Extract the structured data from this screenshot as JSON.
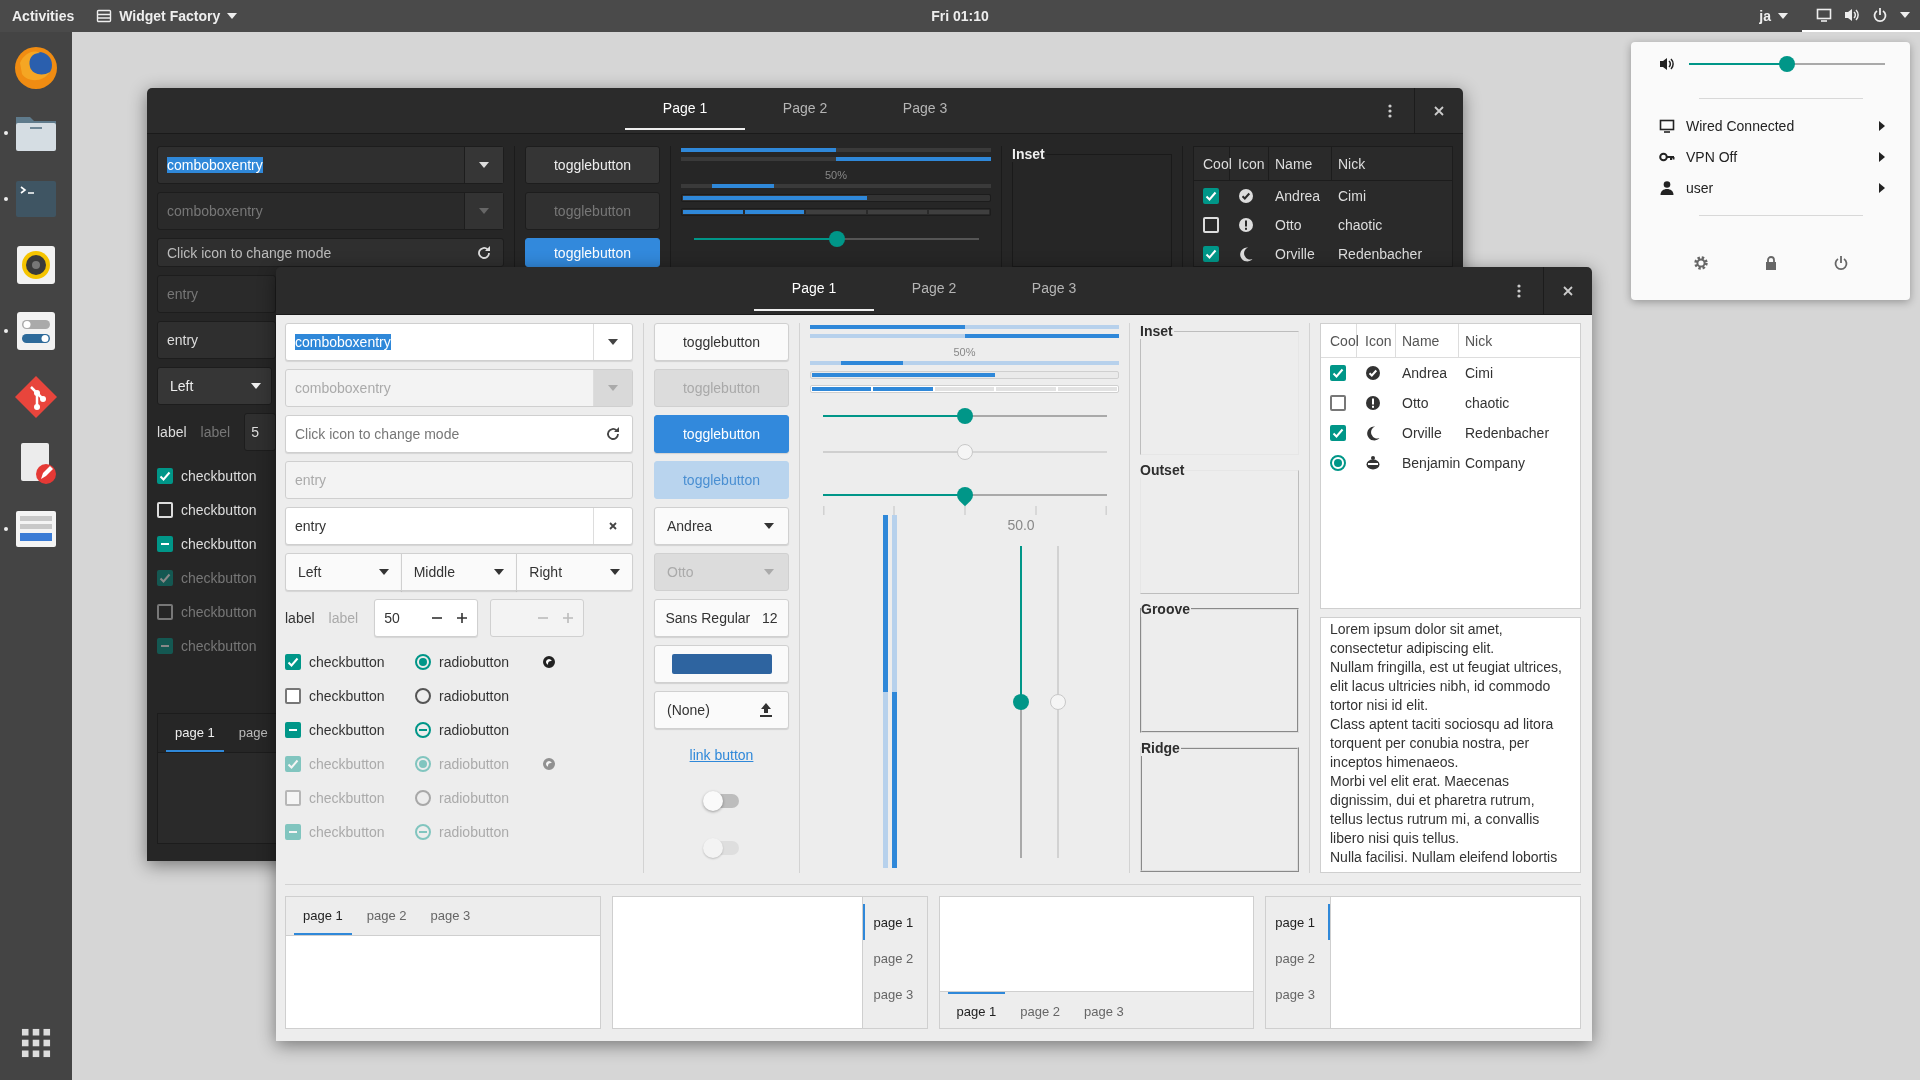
{
  "top_bar": {
    "activities": "Activities",
    "app_menu": "Widget Factory",
    "clock": "Fri 01:10",
    "input_source": "ja"
  },
  "dock": [
    {
      "kind": "browser",
      "running": false
    },
    {
      "kind": "files",
      "running": true
    },
    {
      "kind": "terminal",
      "running": true
    },
    {
      "kind": "music",
      "running": false
    },
    {
      "kind": "settings",
      "running": true
    },
    {
      "kind": "git",
      "running": false
    },
    {
      "kind": "editor",
      "running": false
    },
    {
      "kind": "widgets",
      "running": true
    }
  ],
  "system_menu": {
    "volume": {
      "level": 0.5
    },
    "items": [
      {
        "kind": "network",
        "label": "Wired Connected"
      },
      {
        "kind": "vpn",
        "label": "VPN Off"
      },
      {
        "kind": "user",
        "label": "user"
      }
    ]
  },
  "back_window": {
    "tabs": [
      {
        "label": "Page 1",
        "selected": true
      },
      {
        "label": "Page 2",
        "selected": false
      },
      {
        "label": "Page 3",
        "selected": false
      }
    ],
    "combo_entries": [
      {
        "value": "comboboxentry",
        "text_selected": true,
        "disabled": false
      },
      {
        "value": "comboboxentry",
        "text_selected": false,
        "disabled": true
      }
    ],
    "mode_entry": {
      "placeholder": "Click icon to change mode"
    },
    "entries": [
      {
        "value": "entry",
        "disabled": true
      },
      {
        "value": "entry",
        "disabled": false
      }
    ],
    "combo": {
      "value": "Left"
    },
    "labels": [
      {
        "text": "label",
        "disabled": false
      },
      {
        "text": "label",
        "disabled": true
      }
    ],
    "spin": {
      "value": "5"
    },
    "checkbuttons": [
      {
        "label": "checkbutton",
        "checked": true,
        "inconsistent": false,
        "disabled": false
      },
      {
        "label": "checkbutton",
        "checked": false,
        "inconsistent": false,
        "disabled": false
      },
      {
        "label": "checkbutton",
        "inconsistent": true,
        "disabled": false
      },
      {
        "label": "checkbutton",
        "checked": true,
        "inconsistent": false,
        "disabled": true
      },
      {
        "label": "checkbutton",
        "checked": false,
        "inconsistent": false,
        "disabled": true
      },
      {
        "label": "checkbutton",
        "inconsistent": true,
        "disabled": true
      }
    ],
    "togglebuttons": [
      {
        "label": "togglebutton",
        "active": false,
        "disabled": false
      },
      {
        "label": "togglebutton",
        "active": false,
        "disabled": true
      },
      {
        "label": "togglebutton",
        "active": true,
        "disabled": false
      }
    ],
    "progress": [
      {
        "kind": "plain",
        "level": 0.5
      },
      {
        "kind": "inverted",
        "level": 0.5
      },
      {
        "kind": "pulse"
      },
      {
        "kind": "trough",
        "level": 0.6
      },
      {
        "kind": "segmented",
        "level": 0.4
      }
    ],
    "progress_text": "50%",
    "scale": {
      "level": 0.5
    },
    "frame": {
      "label": "Inset"
    },
    "tree": {
      "columns": [
        "Cool",
        "Icon",
        "Name",
        "Nick"
      ],
      "rows": [
        {
          "kind": "check",
          "checked": true,
          "name": "Andrea",
          "nick": "Cimi"
        },
        {
          "kind": "check",
          "checked": false,
          "name": "Otto",
          "nick": "chaotic"
        },
        {
          "kind": "check",
          "checked": true,
          "name": "Orville",
          "nick": "Redenbacher"
        }
      ]
    },
    "notebook": {
      "tabs": [
        {
          "label": "page 1",
          "selected": true
        },
        {
          "label": "page",
          "selected": false
        }
      ]
    }
  },
  "front_window": {
    "tabs": [
      {
        "label": "Page 1",
        "selected": true
      },
      {
        "label": "Page 2",
        "selected": false
      },
      {
        "label": "Page 3",
        "selected": false
      }
    ],
    "combo_entries": [
      {
        "value": "comboboxentry",
        "text_selected": true,
        "disabled": false
      },
      {
        "value": "comboboxentry",
        "text_selected": false,
        "disabled": true
      }
    ],
    "mode_entry": {
      "placeholder": "Click icon to change mode"
    },
    "entries": [
      {
        "value": "entry",
        "disabled": true,
        "clearable": false
      },
      {
        "value": "entry",
        "disabled": false,
        "clearable": true
      }
    ],
    "linked_combos": [
      {
        "value": "Left"
      },
      {
        "value": "Middle"
      },
      {
        "value": "Right"
      }
    ],
    "labels": [
      {
        "text": "label",
        "disabled": false
      },
      {
        "text": "label",
        "disabled": true
      }
    ],
    "spins": [
      {
        "value": "50",
        "disabled": false
      },
      {
        "disabled": true
      }
    ],
    "check_rows": [
      {
        "disabled": false,
        "check": {
          "label": "checkbutton",
          "checked": true,
          "inconsistent": false
        },
        "radio": {
          "label": "radiobutton",
          "checked": true,
          "inconsistent": false
        },
        "dot": true
      },
      {
        "disabled": false,
        "check": {
          "label": "checkbutton",
          "checked": false,
          "inconsistent": false
        },
        "radio": {
          "label": "radiobutton",
          "checked": false,
          "inconsistent": false
        },
        "dot": false
      },
      {
        "disabled": false,
        "check": {
          "label": "checkbutton",
          "inconsistent": true
        },
        "radio": {
          "label": "radiobutton",
          "inconsistent": true
        },
        "dot": false
      },
      {
        "disabled": true,
        "check": {
          "label": "checkbutton",
          "checked": true,
          "inconsistent": false
        },
        "radio": {
          "label": "radiobutton",
          "checked": true,
          "inconsistent": false
        },
        "dot": true
      },
      {
        "disabled": true,
        "check": {
          "label": "checkbutton",
          "checked": false,
          "inconsistent": false
        },
        "radio": {
          "label": "radiobutton",
          "checked": false,
          "inconsistent": false
        },
        "dot": false
      },
      {
        "disabled": true,
        "check": {
          "label": "checkbutton",
          "inconsistent": true
        },
        "radio": {
          "label": "radiobutton",
          "inconsistent": true
        },
        "dot": false
      }
    ],
    "togglebuttons": [
      {
        "label": "togglebutton",
        "active": false,
        "disabled": false
      },
      {
        "label": "togglebutton",
        "active": false,
        "disabled": true
      },
      {
        "label": "togglebutton",
        "active": true,
        "disabled": false
      },
      {
        "label": "togglebutton",
        "active": true,
        "disabled": true
      }
    ],
    "combos": [
      {
        "value": "Andrea",
        "disabled": false
      },
      {
        "value": "Otto",
        "disabled": true
      }
    ],
    "font_button": {
      "family": "Sans Regular",
      "size": "12"
    },
    "color_button": {
      "color": "#2e64a0"
    },
    "file_button": {
      "value": "(None)"
    },
    "link": {
      "label": "link button"
    },
    "switches": [
      {
        "on": false,
        "disabled": false
      },
      {
        "on": false,
        "disabled": true
      }
    ],
    "progress": [
      {
        "kind": "plain",
        "level": 0.5
      },
      {
        "kind": "inverted",
        "level": 0.5
      },
      {
        "kind": "pulse"
      },
      {
        "kind": "trough",
        "level": 0.6
      },
      {
        "kind": "segmented",
        "level": 0.4
      }
    ],
    "progress_text": "50%",
    "scales": [
      {
        "level": 0.5,
        "disabled": false,
        "marks": false
      },
      {
        "level": 0.5,
        "disabled": true,
        "marks": false
      },
      {
        "level": 0.5,
        "disabled": false,
        "marks": true
      }
    ],
    "vertical_bars": [
      {
        "level": 0.5,
        "inverted": false
      },
      {
        "level": 0.5,
        "inverted": true
      }
    ],
    "vertical_scales": [
      {
        "level": 0.5,
        "disabled": false,
        "value": "50.0"
      },
      {
        "level": 0.5,
        "disabled": true
      }
    ],
    "frames": [
      {
        "label": "Inset",
        "kind": "inset"
      },
      {
        "label": "Outset",
        "kind": "outset"
      },
      {
        "label": "Groove",
        "kind": "groove"
      },
      {
        "label": "Ridge",
        "kind": "ridge"
      }
    ],
    "tree": {
      "columns": [
        "Cool",
        "Icon",
        "Name",
        "Nick"
      ],
      "rows": [
        {
          "kind": "check",
          "checked": true,
          "name": "Andrea",
          "nick": "Cimi"
        },
        {
          "kind": "check",
          "checked": false,
          "name": "Otto",
          "nick": "chaotic"
        },
        {
          "kind": "check",
          "checked": true,
          "name": "Orville",
          "nick": "Redenbacher"
        },
        {
          "kind": "radio",
          "checked": true,
          "name": "Benjamin",
          "nick": "Company"
        }
      ]
    },
    "text_view": [
      "Lorem ipsum dolor sit amet, consectetur adipiscing elit.",
      "Nullam fringilla, est ut feugiat ultrices, elit lacus ultricies nibh, id commodo tortor nisi id elit.",
      "Class aptent taciti sociosqu ad litora torquent per conubia nostra, per inceptos himenaeos.",
      "Morbi vel elit erat. Maecenas dignissim, dui et pharetra rutrum, tellus lectus rutrum mi, a convallis libero nisi quis tellus.",
      "Nulla facilisi. Nullam eleifend lobortis"
    ],
    "notebooks": [
      {
        "kind": "top",
        "tabs": [
          {
            "label": "page 1",
            "selected": true
          },
          {
            "label": "page 2",
            "selected": false
          },
          {
            "label": "page 3",
            "selected": false
          }
        ]
      },
      {
        "kind": "right",
        "tabs": [
          {
            "label": "page 1",
            "selected": true
          },
          {
            "label": "page 2",
            "selected": false
          },
          {
            "label": "page 3",
            "selected": false
          }
        ]
      },
      {
        "kind": "bottom",
        "tabs": [
          {
            "label": "page 1",
            "selected": true
          },
          {
            "label": "page 2",
            "selected": false
          },
          {
            "label": "page 3",
            "selected": false
          }
        ]
      },
      {
        "kind": "left",
        "tabs": [
          {
            "label": "page 1",
            "selected": true
          },
          {
            "label": "page 2",
            "selected": false
          },
          {
            "label": "page 3",
            "selected": false
          }
        ]
      }
    ]
  }
}
